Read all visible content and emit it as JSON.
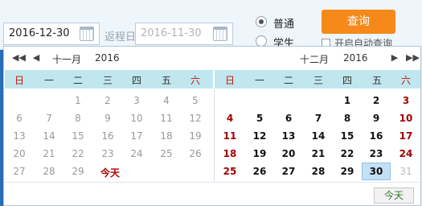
{
  "search": {
    "depart_date": "2016-12-30",
    "return_label": "返程日",
    "return_date": "2016-11-30",
    "radio_normal": "普通",
    "radio_student": "学生",
    "query_button": "查询",
    "auto_query_label": "开启自动查询"
  },
  "picker": {
    "left_month": "十一月",
    "left_year": "2016",
    "right_month": "十二月",
    "right_year": "2016",
    "weekdays": [
      "日",
      "一",
      "二",
      "三",
      "四",
      "五",
      "六"
    ],
    "today_link": "今天",
    "today_button": "今天"
  }
}
